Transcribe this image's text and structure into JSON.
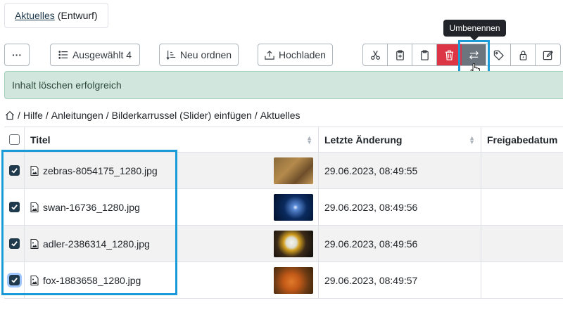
{
  "header": {
    "tab_link": "Aktuelles",
    "tab_status": "(Entwurf)"
  },
  "toolbar": {
    "more_label": "···",
    "selected_label": "Ausgewählt 4",
    "reorder_label": "Neu ordnen",
    "upload_label": "Hochladen",
    "icons": [
      "scissors-icon",
      "paste-into-icon",
      "clipboard-icon",
      "trash-icon",
      "rename-icon",
      "tag-icon",
      "lock-icon",
      "edit-icon"
    ]
  },
  "tooltip": {
    "text": "Umbenennen"
  },
  "alert": {
    "message": "Inhalt löschen erfolgreich"
  },
  "breadcrumb": {
    "items": [
      "Hilfe",
      "Anleitungen",
      "Bilderkarrussel (Slider) einfügen",
      "Aktuelles"
    ],
    "separator": "/"
  },
  "table": {
    "columns": [
      "Titel",
      "Letzte Änderung",
      "Freigabedatum"
    ],
    "rows": [
      {
        "name": "zebras-8054175_1280.jpg",
        "modified": "29.06.2023, 08:49:55",
        "checked": true
      },
      {
        "name": "swan-16736_1280.jpg",
        "modified": "29.06.2023, 08:49:56",
        "checked": true
      },
      {
        "name": "adler-2386314_1280.jpg",
        "modified": "29.06.2023, 08:49:56",
        "checked": true
      },
      {
        "name": "fox-1883658_1280.jpg",
        "modified": "29.06.2023, 08:49:57",
        "checked": true
      }
    ]
  },
  "colors": {
    "accent": "#1f3a4d",
    "highlight": "#1a9ad6",
    "danger": "#dc3545",
    "success_bg": "#d1e7dd"
  }
}
